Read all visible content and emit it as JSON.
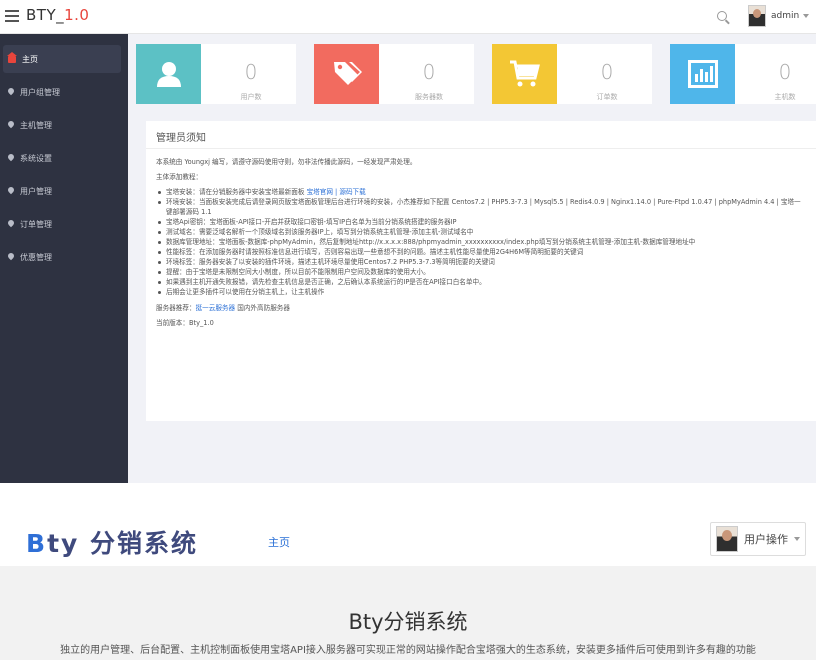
{
  "admin": {
    "brand": "BTY_",
    "brand_version": "1.0",
    "user": "admin",
    "sidebar": [
      {
        "label": "主页",
        "active": true
      },
      {
        "label": "用户组管理",
        "active": false
      },
      {
        "label": "主机管理",
        "active": false
      },
      {
        "label": "系统设置",
        "active": false
      },
      {
        "label": "用户管理",
        "active": false
      },
      {
        "label": "订单管理",
        "active": false
      },
      {
        "label": "优惠管理",
        "active": false
      }
    ],
    "stats": [
      {
        "value": "0",
        "label": "用户数",
        "color": "#5cc1c5",
        "icon": "user-icon"
      },
      {
        "value": "0",
        "label": "服务器数",
        "color": "#f26b5f",
        "icon": "tag-icon"
      },
      {
        "value": "0",
        "label": "订单数",
        "color": "#f3c734",
        "icon": "cart-icon"
      },
      {
        "value": "0",
        "label": "主机数",
        "color": "#4fb6ea",
        "icon": "chart-icon"
      }
    ],
    "notice": {
      "title": "管理员须知",
      "intro": "本系统由 Youngxj 编写，请遵守源码使用守则，勿非法传播此源码，一经发现严肃处理。",
      "host_heading": "主体添加教程：",
      "host_items": [
        {
          "text": "宝塔安装：请在分销服务器中安装宝塔最新面板 ",
          "link": "宝塔官网 | 源码下载"
        },
        {
          "text": "环境安装：当面板安装完成后请登录网页版宝塔面板管理后台进行环境的安装，小杰推荐如下配置 Centos7.2 | PHP5.3-7.3 | Mysql5.5 | Redis4.0.9 | Nginx1.14.0 | Pure-Ftpd 1.0.47 | phpMyAdmin 4.4 | 宝塔一键部署源码 1.1",
          "link": ""
        },
        {
          "text": "宝塔Api密钥：宝塔面板-API接口-开启并获取接口密钥-填写IP白名单为当前分销系统搭建的服务器IP",
          "link": ""
        },
        {
          "text": "测试域名：需要泛域名解析一个顶级域名到该服务器IP上，填写到分销系统主机管理-添加主机-测试域名中",
          "link": ""
        },
        {
          "text": "数据库管理地址：宝塔面板-数据库-phpMyAdmin，然后复制地址http://x.x.x.x:888/phpmyadmin_xxxxxxxxxx/index.php填写到分销系统主机管理-添加主机-数据库管理地址中",
          "link": ""
        }
      ],
      "extra_items": [
        "性能标签：在添加服务器时请按照标准信息进行填写，否则容易出现一些意想不到的问题。描述主机性能尽量使用2G4H6M等简明扼要的关键词",
        "环境标签：服务器安装了以安装的插件环境，描述主机环境尽量使用Centos7.2 PHP5.3-7.3等简明扼要的关键词",
        "提醒：由于宝塔是未限制空间大小制度，所以目前不能限制用户空间及数据库的使用大小。",
        "如果遇到主机开通失败报错，请先检查主机信息是否正确，之后确认本系统运行的IP是否在API接口白名单中。",
        "后期会让更多插件可以使用在分销主机上，让主机操作"
      ],
      "recommend_label": "服务器推荐：",
      "recommend_link": "挺一云服务器",
      "recommend_text": " 国内外高防服务器",
      "version": "当前版本：Bty_1.0"
    }
  },
  "site": {
    "logo_b": "B",
    "logo_rest": "ty 分销系统",
    "nav_home": "主页",
    "user_op": "用户操作",
    "hero_title": "Bty分销系统",
    "hero_sub": "独立的用户管理、后台配置、主机控制面板使用宝塔API接入服务器可实现正常的网站操作配合宝塔强大的生态系统，安装更多插件后可使用到许多有趣的功能"
  }
}
